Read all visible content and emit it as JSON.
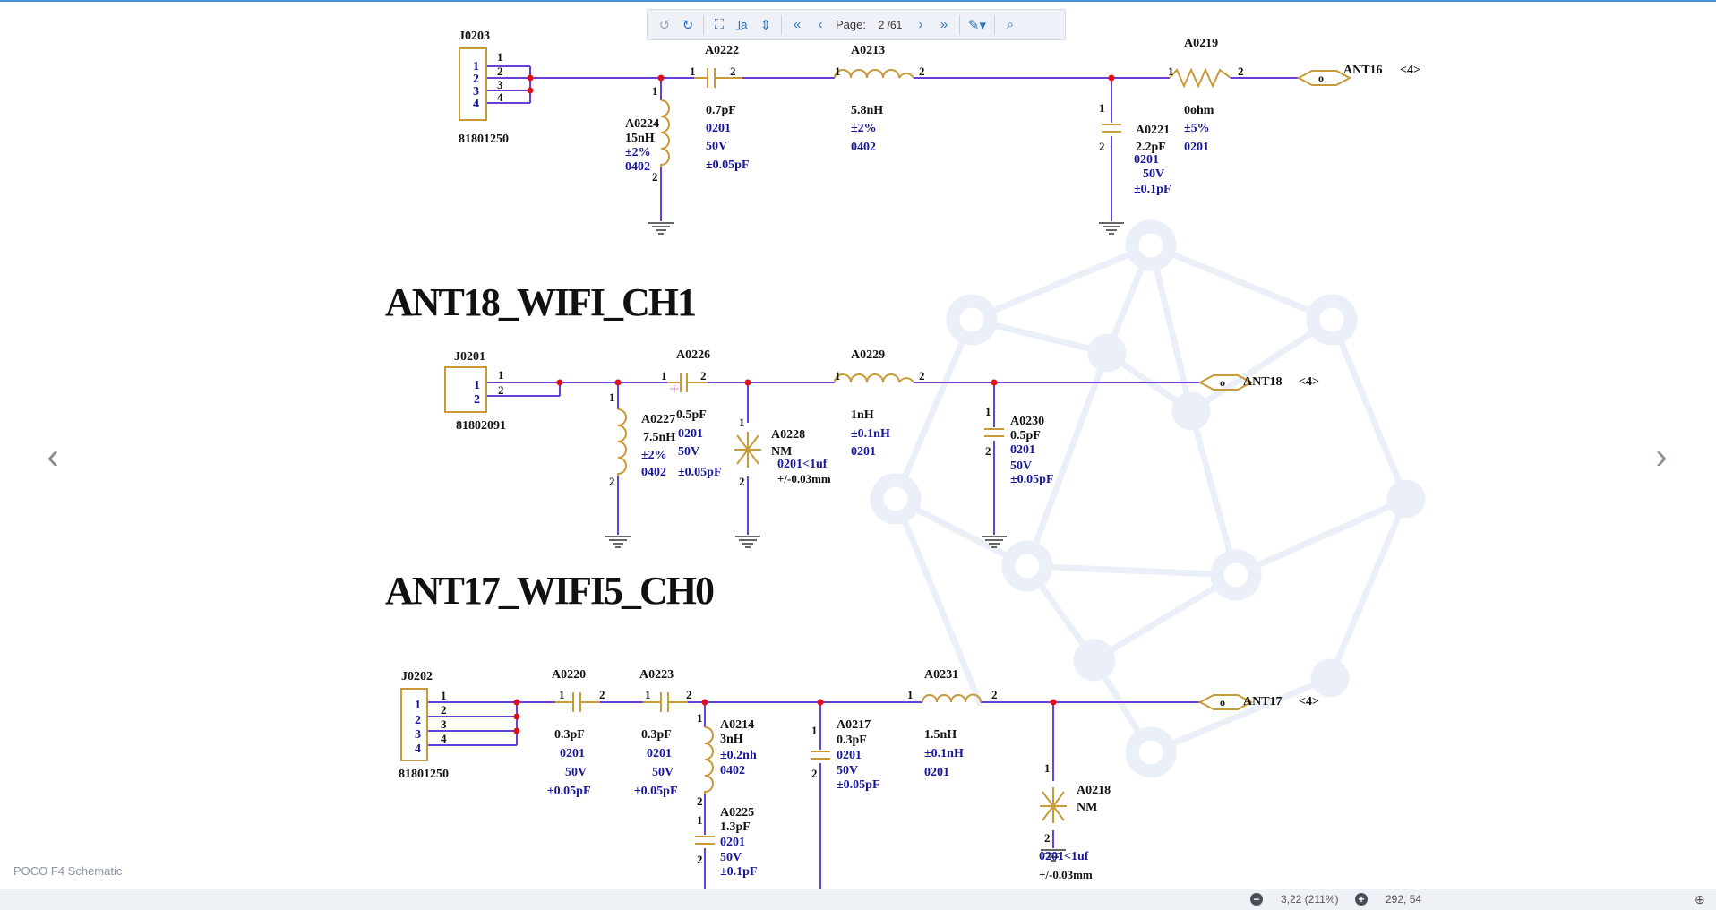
{
  "toolbar": {
    "page_label": "Page:",
    "page_value": "2 /61",
    "buttons": [
      "rotate-ccw-icon",
      "rotate-cw-icon",
      "fit-page-icon",
      "text-select-icon",
      "scroll-mode-icon",
      "first-page-icon",
      "prev-page-icon",
      "next-page-icon",
      "last-page-icon",
      "annotate-icon",
      "search-icon"
    ]
  },
  "document_title": "POCO F4 Schematic",
  "status": {
    "zoom": "3,22 (211%)",
    "coords": "292, 54"
  },
  "colors": {
    "wire": "#6a3fd6",
    "component": "#c89a3a",
    "value_text": "#17169a",
    "net_text": "#111111",
    "node": "#e0101a",
    "toolbar_icon": "#2f6fb7"
  },
  "schematic": {
    "section1": {
      "j0203": {
        "ref": "J0203",
        "part": "81801250",
        "pins": [
          "1",
          "2",
          "3",
          "4"
        ]
      },
      "a0222": {
        "ref": "A0222",
        "value": "0.7pF",
        "pkg": "0201",
        "volt": "50V",
        "tol": "±0.05pF"
      },
      "a0224": {
        "ref": "A0224",
        "value": "15nH",
        "tol": "±2%",
        "pkg": "0402"
      },
      "a0213": {
        "ref": "A0213",
        "value": "5.8nH",
        "tol": "±2%",
        "pkg": "0402"
      },
      "a0221": {
        "ref": "A0221",
        "value": "2.2pF",
        "pkg": "0201",
        "volt": "50V",
        "tol": "±0.1pF"
      },
      "a0219": {
        "ref": "A0219",
        "value": "0ohm",
        "tol": "±5%",
        "pkg": "0201"
      },
      "port": {
        "name": "ANT16",
        "page": "<4>"
      }
    },
    "section2": {
      "title": "ANT18_WIFI_CH1",
      "j0201": {
        "ref": "J0201",
        "part": "81802091",
        "pins": [
          "1",
          "2"
        ]
      },
      "a0226": {
        "ref": "A0226",
        "value": "0.5pF",
        "pkg": "0201",
        "volt": "50V",
        "tol": "±0.05pF"
      },
      "a0227": {
        "ref": "A0227",
        "value": "7.5nH",
        "tol": "±2%",
        "pkg": "0402"
      },
      "a0228": {
        "ref": "A0228",
        "value": "NM",
        "spec": "0201<1uf",
        "tol": "+/-0.03mm"
      },
      "a0229": {
        "ref": "A0229",
        "value": "1nH",
        "tol": "±0.1nH",
        "pkg": "0201"
      },
      "a0230": {
        "ref": "A0230",
        "value": "0.5pF",
        "pkg": "0201",
        "volt": "50V",
        "tol": "±0.05pF"
      },
      "port": {
        "name": "ANT18",
        "page": "<4>"
      }
    },
    "section3": {
      "title": "ANT17_WIFI5_CH0",
      "j0202": {
        "ref": "J0202",
        "part": "81801250",
        "pins": [
          "1",
          "2",
          "3",
          "4"
        ]
      },
      "a0220": {
        "ref": "A0220",
        "value": "0.3pF",
        "pkg": "0201",
        "volt": "50V",
        "tol": "±0.05pF"
      },
      "a0223": {
        "ref": "A0223",
        "value": "0.3pF",
        "pkg": "0201",
        "volt": "50V",
        "tol": "±0.05pF"
      },
      "a0214": {
        "ref": "A0214",
        "value": "3nH",
        "tol": "±0.2nh",
        "pkg": "0402"
      },
      "a0225": {
        "ref": "A0225",
        "value": "1.3pF",
        "pkg": "0201",
        "volt": "50V",
        "tol": "±0.1pF"
      },
      "a0217": {
        "ref": "A0217",
        "value": "0.3pF",
        "pkg": "0201",
        "volt": "50V",
        "tol": "±0.05pF"
      },
      "a0231": {
        "ref": "A0231",
        "value": "1.5nH",
        "tol": "±0.1nH",
        "pkg": "0201"
      },
      "a0218": {
        "ref": "A0218",
        "value": "NM",
        "spec": "0201<1uf",
        "tol": "+/-0.03mm"
      },
      "port": {
        "name": "ANT17",
        "page": "<4>"
      }
    },
    "pin_labels": {
      "p1": "1",
      "p2": "2",
      "port_mark": "o"
    }
  }
}
